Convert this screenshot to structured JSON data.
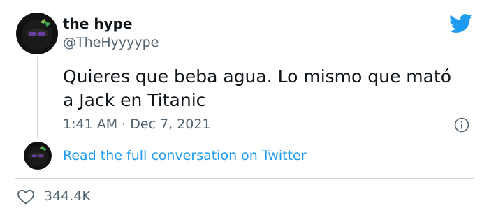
{
  "author": {
    "display_name": "the hype",
    "handle": "@TheHyyyype"
  },
  "tweet": {
    "text": "Quieres que beba agua. Lo mismo que mató a Jack en Titanic",
    "timestamp": "1:41 AM · Dec 7, 2021"
  },
  "conversation_link": "Read the full conversation on Twitter",
  "engagement": {
    "likes": "344.4K"
  },
  "icons": {
    "brand": "twitter-bird-icon",
    "info": "info-icon",
    "like": "heart-icon"
  },
  "colors": {
    "twitter_blue": "#1d9bf0",
    "text_primary": "#0f1419",
    "text_secondary": "#536471",
    "divider": "#cfd9de"
  }
}
